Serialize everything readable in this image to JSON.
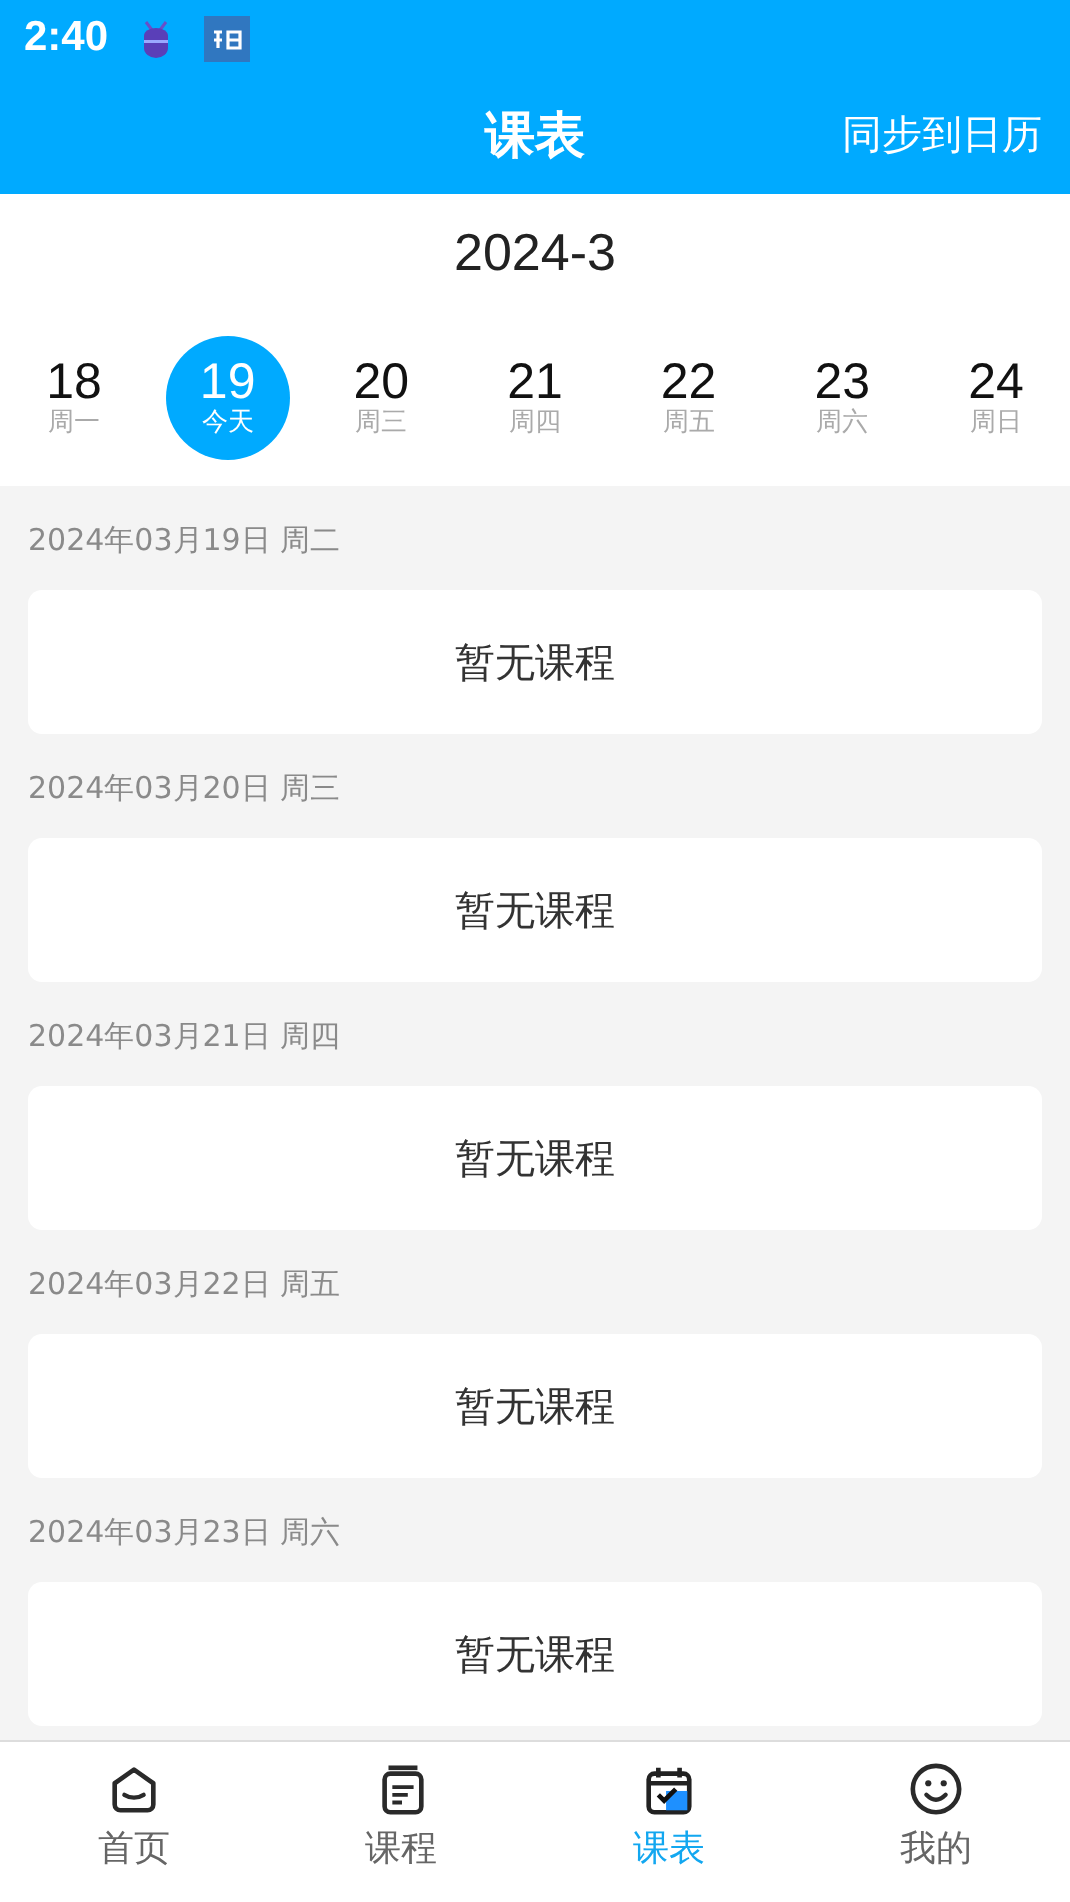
{
  "status_bar": {
    "time": "2:40"
  },
  "header": {
    "title": "课表",
    "action": "同步到日历"
  },
  "month": "2024-3",
  "days": [
    {
      "day": "18",
      "label": "周一",
      "selected": false
    },
    {
      "day": "19",
      "label": "今天",
      "selected": true
    },
    {
      "day": "20",
      "label": "周三",
      "selected": false
    },
    {
      "day": "21",
      "label": "周四",
      "selected": false
    },
    {
      "day": "22",
      "label": "周五",
      "selected": false
    },
    {
      "day": "23",
      "label": "周六",
      "selected": false
    },
    {
      "day": "24",
      "label": "周日",
      "selected": false
    }
  ],
  "schedule": [
    {
      "date": "2024年03月19日 周二",
      "message": "暂无课程"
    },
    {
      "date": "2024年03月20日 周三",
      "message": "暂无课程"
    },
    {
      "date": "2024年03月21日 周四",
      "message": "暂无课程"
    },
    {
      "date": "2024年03月22日 周五",
      "message": "暂无课程"
    },
    {
      "date": "2024年03月23日 周六",
      "message": "暂无课程"
    }
  ],
  "tab_bar": [
    {
      "label": "首页",
      "kind": "home",
      "selected": false
    },
    {
      "label": "课程",
      "kind": "course",
      "selected": false
    },
    {
      "label": "课表",
      "kind": "calendar",
      "selected": true
    },
    {
      "label": "我的",
      "kind": "profile",
      "selected": false
    }
  ]
}
